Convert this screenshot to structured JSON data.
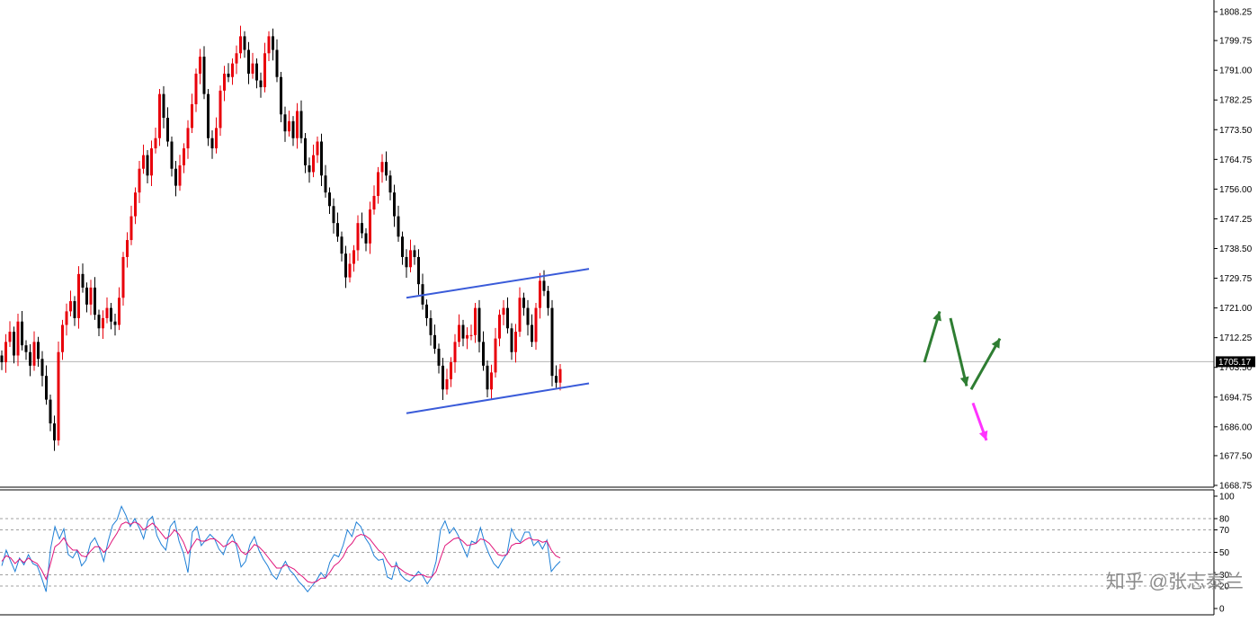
{
  "chart_data": [
    {
      "type": "candlestick",
      "title": "",
      "y_ticks": [
        "1808.25",
        "1799.75",
        "1791.00",
        "1782.25",
        "1773.50",
        "1764.75",
        "1756.00",
        "1747.25",
        "1738.50",
        "1729.75",
        "1721.00",
        "1712.25",
        "1703.50",
        "1694.75",
        "1686.00",
        "1677.50",
        "1668.75"
      ],
      "ylim": [
        1668.75,
        1808.25
      ],
      "current_price": "1705.17",
      "grid": false,
      "close_path": [
        1705,
        1711,
        1714,
        1707,
        1717,
        1710,
        1708,
        1704,
        1711,
        1706,
        1701,
        1694,
        1687,
        1682,
        1708,
        1716,
        1720,
        1723,
        1718,
        1731,
        1727,
        1722,
        1727,
        1719,
        1715,
        1718,
        1721,
        1717,
        1716,
        1724,
        1736,
        1741,
        1748,
        1755,
        1762,
        1766,
        1760,
        1768,
        1771,
        1784,
        1777,
        1770,
        1762,
        1757,
        1763,
        1768,
        1774,
        1781,
        1790,
        1795,
        1784,
        1771,
        1768,
        1774,
        1785,
        1790,
        1789,
        1793,
        1796,
        1801,
        1797,
        1790,
        1793,
        1788,
        1786,
        1796,
        1801,
        1797,
        1789,
        1778,
        1773,
        1776,
        1771,
        1779,
        1771,
        1763,
        1761,
        1766,
        1770,
        1760,
        1755,
        1751,
        1746,
        1742,
        1737,
        1730,
        1734,
        1738,
        1746,
        1743,
        1740,
        1750,
        1754,
        1761,
        1764,
        1760,
        1755,
        1748,
        1742,
        1736,
        1733,
        1738,
        1736,
        1728,
        1722,
        1718,
        1713,
        1709,
        1704,
        1697,
        1700,
        1705,
        1711,
        1716,
        1712,
        1713,
        1713,
        1721,
        1711,
        1704,
        1697,
        1702,
        1712,
        1719,
        1721,
        1715,
        1708,
        1714,
        1724,
        1721,
        1716,
        1711,
        1721,
        1729,
        1726,
        1721,
        1701,
        1699,
        1703
      ],
      "channel": {
        "upper": [
          {
            "bar": 0,
            "price": 1724.0
          },
          {
            "bar": 1,
            "price": 1732.5
          }
        ],
        "lower": [
          {
            "bar": 0,
            "price": 1690.0
          },
          {
            "bar": 1,
            "price": 1698.8
          }
        ]
      },
      "projections": [
        {
          "color": "#2e7d32",
          "from": 1705,
          "to": 1720
        },
        {
          "color": "#2e7d32",
          "from": 1718,
          "to": 1698
        },
        {
          "color": "#2e7d32",
          "from": 1697,
          "to": 1712
        },
        {
          "color": "#ff33ff",
          "from": 1693,
          "to": 1682
        }
      ],
      "colors": {
        "bull": "#e8000b",
        "bear": "#000000",
        "channel": "#3a5bd9",
        "price_line": "#b4b4b4",
        "price_tag_bg": "#000000"
      }
    },
    {
      "type": "line",
      "title": "",
      "y_ticks": [
        "100",
        "80",
        "70",
        "50",
        "30",
        "20",
        "0"
      ],
      "ylim": [
        0,
        100
      ],
      "levels": [
        80,
        70,
        50,
        30,
        20
      ],
      "series": [
        {
          "color": "#1e7fd6",
          "values": [
            38,
            52,
            42,
            33,
            45,
            39,
            48,
            40,
            38,
            27,
            15,
            53,
            73,
            62,
            71,
            48,
            45,
            52,
            38,
            43,
            58,
            63,
            54,
            42,
            60,
            74,
            79,
            91,
            83,
            73,
            80,
            72,
            62,
            78,
            82,
            65,
            57,
            52,
            73,
            78,
            60,
            49,
            32,
            68,
            73,
            56,
            61,
            66,
            62,
            53,
            48,
            60,
            66,
            55,
            37,
            42,
            57,
            64,
            52,
            44,
            38,
            30,
            26,
            35,
            42,
            34,
            30,
            24,
            20,
            15,
            20,
            25,
            32,
            27,
            41,
            48,
            46,
            56,
            70,
            64,
            77,
            73,
            63,
            57,
            47,
            43,
            44,
            28,
            26,
            41,
            30,
            26,
            24,
            28,
            33,
            29,
            22,
            28,
            42,
            70,
            78,
            67,
            72,
            65,
            55,
            46,
            60,
            58,
            72,
            58,
            48,
            40,
            36,
            43,
            49,
            71,
            63,
            59,
            68,
            68,
            56,
            60,
            53,
            61,
            33,
            38,
            42
          ]
        },
        {
          "color": "#e0157a",
          "values": [
            42,
            47,
            45,
            40,
            44,
            41,
            45,
            42,
            40,
            34,
            26,
            40,
            55,
            58,
            63,
            56,
            52,
            52,
            47,
            46,
            51,
            55,
            55,
            50,
            54,
            61,
            67,
            75,
            77,
            75,
            77,
            75,
            70,
            73,
            76,
            72,
            67,
            62,
            65,
            70,
            66,
            59,
            49,
            56,
            62,
            60,
            60,
            62,
            62,
            59,
            55,
            57,
            60,
            58,
            51,
            48,
            52,
            57,
            55,
            51,
            46,
            41,
            36,
            36,
            39,
            37,
            35,
            31,
            28,
            24,
            23,
            24,
            27,
            27,
            32,
            38,
            41,
            46,
            54,
            58,
            64,
            66,
            65,
            62,
            57,
            52,
            49,
            42,
            37,
            38,
            35,
            32,
            30,
            29,
            30,
            30,
            28,
            28,
            33,
            45,
            56,
            59,
            62,
            63,
            60,
            56,
            57,
            58,
            62,
            61,
            58,
            53,
            48,
            47,
            48,
            56,
            58,
            58,
            61,
            63,
            61,
            61,
            59,
            60,
            52,
            47,
            45
          ]
        }
      ]
    }
  ],
  "watermark": "知乎 @张志泰兰"
}
